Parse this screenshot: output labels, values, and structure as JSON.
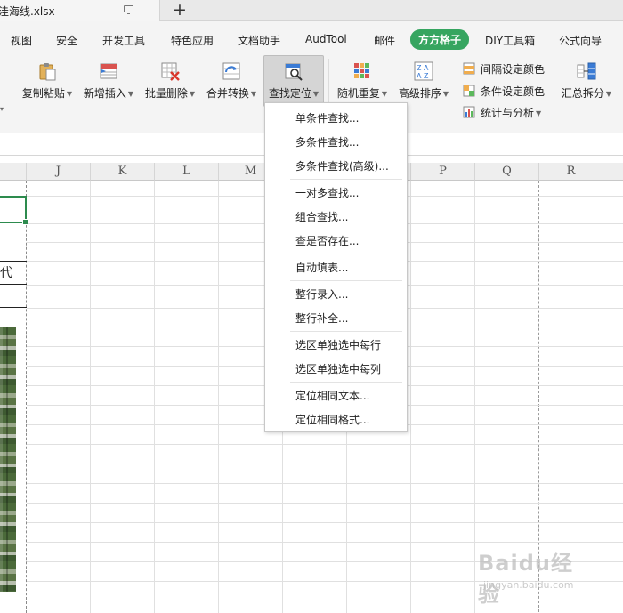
{
  "tab": {
    "filename": "洼海线.xlsx",
    "add_symbol": "+"
  },
  "menu": {
    "items": [
      "视图",
      "安全",
      "开发工具",
      "特色应用",
      "文档助手",
      "AudTool",
      "邮件",
      "方方格子",
      "DIY工具箱",
      "公式向导"
    ],
    "active": "方方格子"
  },
  "ribbon": {
    "copy_paste": "复制粘贴",
    "add_insert": "新增插入",
    "batch_delete": "批量删除",
    "merge_convert": "合并转换",
    "find_locate": "查找定位",
    "random_repeat": "随机重复",
    "advanced_sort": "高级排序",
    "interval_color": "间隔设定颜色",
    "condition_color": "条件设定颜色",
    "stats_analysis": "统计与分析",
    "summary_split": "汇总拆分"
  },
  "columns": [
    "J",
    "K",
    "L",
    "M",
    "N",
    "O",
    "P",
    "Q",
    "R"
  ],
  "cells": {
    "left_text": "代"
  },
  "dropdown": {
    "items": [
      "单条件查找...",
      "多条件查找...",
      "多条件查找(高级)...",
      "一对多查找...",
      "组合查找...",
      "查是否存在...",
      "自动填表...",
      "整行录入...",
      "整行补全...",
      "选区单独选中每行",
      "选区单独选中每列",
      "定位相同文本...",
      "定位相同格式..."
    ]
  },
  "watermark": {
    "brand": "Baidu经验",
    "url": "jingyan.baidu.com"
  },
  "colors": {
    "accent_green": "#36a560",
    "selection_green": "#2d8b4e"
  }
}
